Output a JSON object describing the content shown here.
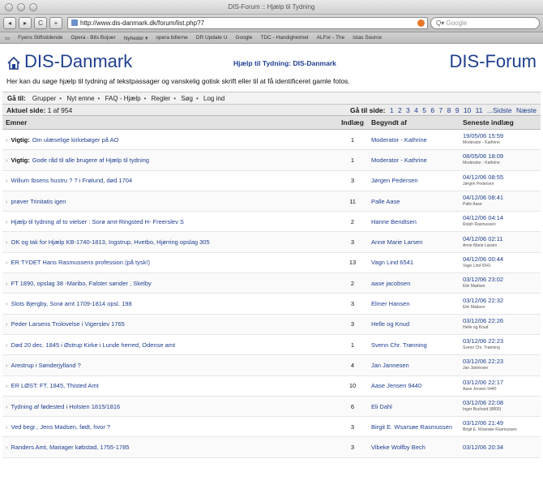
{
  "window": {
    "title": "DIS-Forum :: Hjælp til Tydning"
  },
  "toolbar": {
    "back": "◂",
    "forward": "▸",
    "reload": "C",
    "add": "+",
    "url": "http://www.dis-danmark.dk/forum/list.php?7",
    "search_placeholder": "Google"
  },
  "bookmarks": [
    "Fyens Stiftstidende",
    "Opera - Bits Bojuer",
    "Nyheder ▾",
    "opera billerne",
    "DR Update U",
    "Google",
    "TDC - Handigheimet",
    "ALFor - The",
    "istas Source"
  ],
  "header": {
    "logo": "DIS-Danmark",
    "mid_title": "Hjælp til Tydning: DIS-Danmark",
    "forum_title": "DIS-Forum",
    "intro": "Her kan du søge hjælp til tydning af tekstpassager og vanskelig gotisk skrift eller til at få identificeret gamle fotos."
  },
  "nav": {
    "label": "Gå til:",
    "links": [
      "Grupper",
      "Nyt emne",
      "FAQ - Hjælp",
      "Regler",
      "Søg",
      "Log ind"
    ]
  },
  "pager": {
    "current_label": "Aktuel side:",
    "current_value": "1 af 954",
    "goto_label": "Gå til side:",
    "pages": [
      "1",
      "2",
      "3",
      "4",
      "5",
      "6",
      "7",
      "8",
      "9",
      "10",
      "11",
      "...Sidste",
      "Næste"
    ]
  },
  "table": {
    "headers": {
      "subject": "Emner",
      "count": "Indlæg",
      "author": "Begyndt af",
      "last": "Seneste indlæg"
    },
    "rows": [
      {
        "important": "Vigtig:",
        "subject": "Om ulæselige kirkebøger på AO",
        "count": "1",
        "author": "Moderator - Kathrine",
        "last_date": "19/05/06 15:59",
        "last_user": "Moderator - Kathrine"
      },
      {
        "important": "Vigtig:",
        "subject": "Gode råd til alle brugere af Hjælp til tydning",
        "count": "1",
        "author": "Moderator - Kathrine",
        "last_date": "08/05/06 18:09",
        "last_user": "Moderator - Kathrine"
      },
      {
        "important": "",
        "subject": "Willum Ibsens hustru ? ? i Frølund, død 1704",
        "count": "3",
        "author": "Jørgen Pedersen",
        "last_date": "04/12/06 08:55",
        "last_user": "Jørgen Pedersen"
      },
      {
        "important": "",
        "subject": "prøver Trinitatis igen",
        "count": "11",
        "author": "Palle Aase",
        "last_date": "04/12/06 08:41",
        "last_user": "Palle Aase"
      },
      {
        "important": "",
        "subject": "Hjælp til tydning af to vielser : Sorø amt-Ringsted H- Freerslev S",
        "count": "2",
        "author": "Hanne Bendtsen",
        "last_date": "04/12/06 04:14",
        "last_user": "Rolph Rasmussen"
      },
      {
        "important": "",
        "subject": "OK og tak for Hjælp KB-1740-1813, Ingstrup, Hvetbo, Hjørring opslag 305",
        "count": "3",
        "author": "Anne Marie Larsen",
        "last_date": "04/12/06 02:11",
        "last_user": "Anne Marie Larsen"
      },
      {
        "important": "",
        "subject": "ER TYDET Hans Rasmussens profession (på tysk!)",
        "count": "13",
        "author": "Vagn Lind 6541",
        "last_date": "04/12/06 00:44",
        "last_user": "Vagn Lind 6541"
      },
      {
        "important": "",
        "subject": "FT 1890, opslag 38 -Maribo, Falster sønder , Skelby",
        "count": "2",
        "author": "aase jacobsen",
        "last_date": "03/12/06 23:02",
        "last_user": "Elin Madsen"
      },
      {
        "important": "",
        "subject": "Slots Bjergby, Sorø amt 1709-1814 opsl. 198",
        "count": "3",
        "author": "Elmer Hansen",
        "last_date": "03/12/06 22:32",
        "last_user": "Elin Madsen"
      },
      {
        "important": "",
        "subject": "Peder Larsens Trolovelse i Vigerslev 1765",
        "count": "3",
        "author": "Helle og Knud",
        "last_date": "03/12/06 22:26",
        "last_user": "Helle og Knud"
      },
      {
        "important": "",
        "subject": "Død 20 dec. 1845 i Østrup Kirke i Lunde herred, Odense amt",
        "count": "1",
        "author": "Svenn Chr. Trønning",
        "last_date": "03/12/06 22:23",
        "last_user": "Svenn Chr. Trønning"
      },
      {
        "important": "",
        "subject": "Arestrup i Sønderjylland ?",
        "count": "4",
        "author": "Jan Jannesen",
        "last_date": "03/12/06 22:23",
        "last_user": "Jan Jannesen"
      },
      {
        "important": "",
        "subject": "ER LØST: FT. 1845, Thisted Amt",
        "count": "10",
        "author": "Aase Jensen 9440",
        "last_date": "03/12/06 22:17",
        "last_user": "Aase Jensen 9440"
      },
      {
        "important": "",
        "subject": "Tydning af fødested i Holsten 1815/1816",
        "count": "6",
        "author": "Eli Dahl",
        "last_date": "03/12/06 22:08",
        "last_user": "Inger Buchard (8800)"
      },
      {
        "important": "",
        "subject": "Ved begr., Jens Madsen, født, hvor ?",
        "count": "3",
        "author": "Birgit E. Wsarsøe Rasmussen",
        "last_date": "03/12/06 21:49",
        "last_user": "Birgit E. Wsarsøe Rasmussen"
      },
      {
        "important": "",
        "subject": "Randers Amt, Mariager købstad, 1755-1785",
        "count": "3",
        "author": "Vibeke Wolfby Bech",
        "last_date": "03/12/06 20:34",
        "last_user": ""
      }
    ]
  }
}
